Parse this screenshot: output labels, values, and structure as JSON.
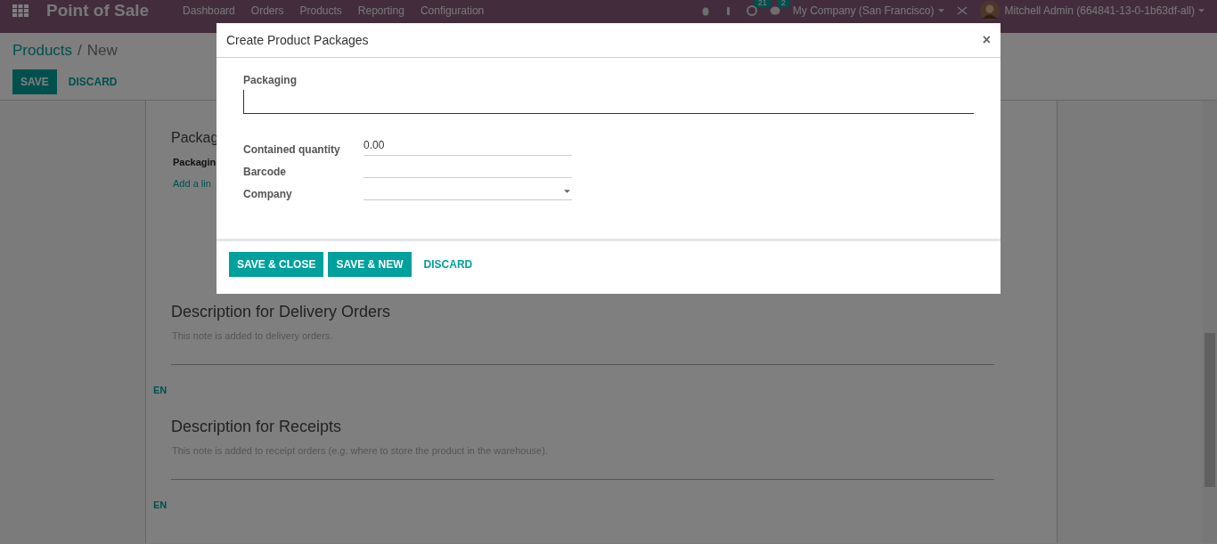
{
  "navbar": {
    "app_title": "Point of Sale",
    "menu": [
      "Dashboard",
      "Orders",
      "Products",
      "Reporting",
      "Configuration"
    ],
    "activity_count": "21",
    "message_count": "2",
    "company": "My Company (San Francisco)",
    "user": "Mitchell Admin (664841-13-0-1b63df-all)"
  },
  "breadcrumb": {
    "parent": "Products",
    "separator": "/",
    "current": "New"
  },
  "actions": [
    {
      "label": "SAVE",
      "kind": "primary"
    },
    {
      "label": "DISCARD",
      "kind": "link"
    }
  ],
  "sheet": {
    "packaging_title": "Packag",
    "packaging_column": "Packagin",
    "add_line": "Add a lin",
    "sections": [
      {
        "title": "Description for Delivery Orders",
        "placeholder": "This note is added to delivery orders.",
        "lang": "EN"
      },
      {
        "title": "Description for Receipts",
        "placeholder": "This note is added to receipt orders (e.g. where to store the product in the warehouse).",
        "lang": "EN"
      }
    ]
  },
  "dialog": {
    "title": "Create Product Packages",
    "close": "×",
    "packaging_label": "Packaging",
    "fields": [
      {
        "label": "Contained quantity",
        "value": "0.00",
        "kind": "input"
      },
      {
        "label": "Barcode",
        "kind": "input"
      },
      {
        "label": "Company",
        "kind": "select"
      }
    ],
    "buttons": [
      {
        "label": "SAVE & CLOSE",
        "kind": "primary"
      },
      {
        "label": "SAVE & NEW",
        "kind": "primary"
      },
      {
        "label": "DISCARD",
        "kind": "link"
      }
    ]
  }
}
